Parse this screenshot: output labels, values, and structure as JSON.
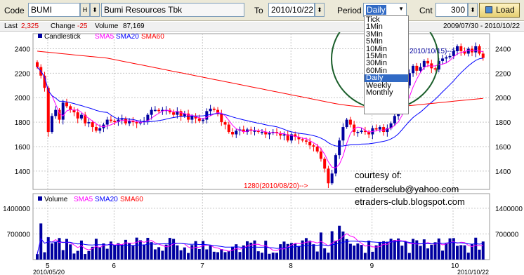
{
  "toolbar": {
    "code_label": "Code",
    "code_value": "BUMI",
    "code_btn": "H",
    "code_arrow": "⬍",
    "company_name": "Bumi Resources Tbk",
    "to_label": "To",
    "to_value": "2010/10/22",
    "to_arrow": "⬍",
    "period_label": "Period",
    "period_value": "Daily",
    "cnt_label": "Cnt",
    "cnt_value": "300",
    "cnt_arrow": "⬍",
    "load_label": "Load"
  },
  "infobar": {
    "last_label": "Last",
    "last_value": "2,325",
    "change_label": "Change",
    "change_value": "-25",
    "volume_label": "Volume",
    "volume_value": "87,169",
    "date_range": "2009/07/30 - 2010/10/22"
  },
  "period_options": [
    "Tick",
    "1Min",
    "3Min",
    "5Min",
    "10Min",
    "15Min",
    "30Min",
    "60Min",
    "Daily",
    "Weekly",
    "Monthly"
  ],
  "period_selected_index": 8,
  "price_legend": [
    {
      "label": "Candlestick",
      "color": "#000000"
    },
    {
      "label": "SMA5",
      "color": "#ff00ff"
    },
    {
      "label": "SMA20",
      "color": "#0000ff"
    },
    {
      "label": "SMA60",
      "color": "#ff0000"
    }
  ],
  "volume_legend": [
    {
      "label": "Volume",
      "color": "#0000a0"
    },
    {
      "label": "SMA5",
      "color": "#ff00ff"
    },
    {
      "label": "SMA20",
      "color": "#0000ff"
    },
    {
      "label": "SMA60",
      "color": "#ff0000"
    }
  ],
  "annotations": {
    "high": "2010/10/15)-->",
    "low": "1280(2010/08/20)-->"
  },
  "courtesy": [
    "courtesy of:",
    "etradersclub@yahoo.com",
    "etraders-club.blogspot.com"
  ],
  "colors": {
    "up": "#0000a0",
    "down": "#ff0000",
    "highlight": "#1a5e2a"
  },
  "chart_data": [
    {
      "type": "candlestick",
      "title": "",
      "ylim": [
        1250,
        2500
      ],
      "y_ticks": [
        1400,
        1600,
        1800,
        2000,
        2200,
        2400
      ],
      "x_month_ticks": [
        "5",
        "6",
        "7",
        "8",
        "9",
        "10"
      ],
      "x_start_label": "2010/05/20",
      "x_end_label": "2010/10/22",
      "close": [
        2250,
        2180,
        2080,
        1720,
        1850,
        1900,
        1820,
        1960,
        1930,
        1900,
        1880,
        1830,
        1860,
        1790,
        1800,
        1760,
        1730,
        1750,
        1780,
        1820,
        1810,
        1800,
        1820,
        1830,
        1790,
        1810,
        1800,
        1790,
        1800,
        1810,
        1860,
        1900,
        1900,
        1890,
        1900,
        1900,
        1880,
        1860,
        1890,
        1850,
        1870,
        1820,
        1850,
        1830,
        1810,
        1820,
        1890,
        1910,
        1900,
        1870,
        1800,
        1780,
        1720,
        1700,
        1730,
        1740,
        1720,
        1740,
        1730,
        1730,
        1720,
        1720,
        1700,
        1710,
        1720,
        1710,
        1690,
        1700,
        1650,
        1700,
        1680,
        1660,
        1650,
        1640,
        1610,
        1600,
        1560,
        1500,
        1420,
        1300,
        1380,
        1530,
        1650,
        1760,
        1820,
        1780,
        1720,
        1720,
        1730,
        1720,
        1700,
        1750,
        1740,
        1760,
        1720,
        1750,
        1790,
        1850,
        1900,
        1980,
        2100,
        2200,
        2260,
        2220,
        2250,
        2300,
        2280,
        2240,
        2230,
        2300,
        2320,
        2330,
        2340,
        2380,
        2420,
        2380,
        2360,
        2400,
        2370,
        2420,
        2360,
        2325
      ]
    },
    {
      "type": "bar",
      "title": "Volume",
      "ylim": [
        0,
        1800000
      ],
      "y_ticks": [
        700000,
        1400000
      ]
    }
  ]
}
